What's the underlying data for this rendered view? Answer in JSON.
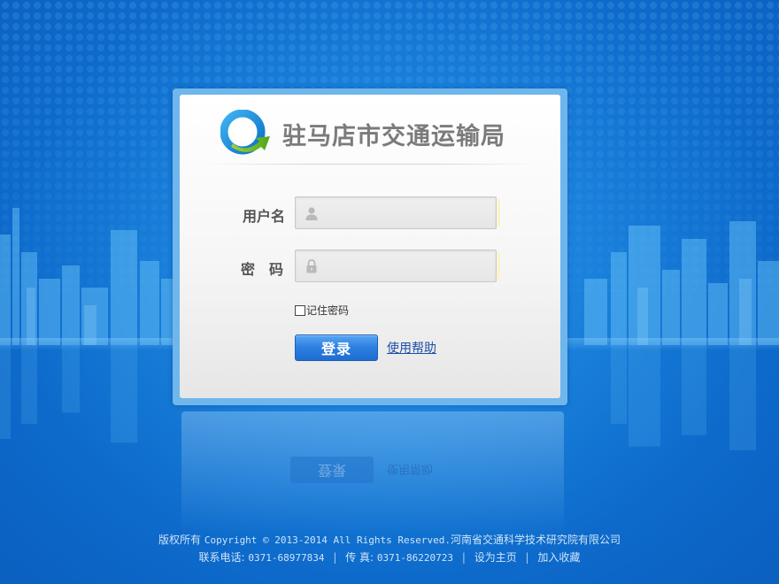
{
  "colors": {
    "background": "#1a82dc",
    "panel": "#f6f6f6",
    "title_text": "#7b7b7b",
    "button": "#2c7ee0",
    "link": "#1d4fa8",
    "footer_text": "#cfe4f7"
  },
  "header": {
    "logo_icon": "logo-circle-arrow-icon",
    "org_name": "驻马店市交通运输局"
  },
  "form": {
    "username": {
      "label": "用户名",
      "icon": "user-icon",
      "value": "",
      "placeholder": ""
    },
    "password": {
      "label_part1": "密",
      "label_part2": "码",
      "icon": "lock-icon",
      "value": "",
      "placeholder": ""
    },
    "remember": {
      "label": "记住密码",
      "checked": false
    },
    "login_label": "登录",
    "help_label": "使用帮助"
  },
  "footer": {
    "copyright_prefix": "版权所有",
    "copyright_text": "Copyright © 2013-2014 All Rights Reserved.",
    "copyright_org": "河南省交通科学技术研究院有限公司",
    "phone_label": "联系电话:",
    "phone_value": "0371-68977834",
    "fax_label": "传 真:",
    "fax_value": "0371-86220723",
    "set_homepage": "设为主页",
    "add_favorite": "加入收藏",
    "separator": "|"
  }
}
